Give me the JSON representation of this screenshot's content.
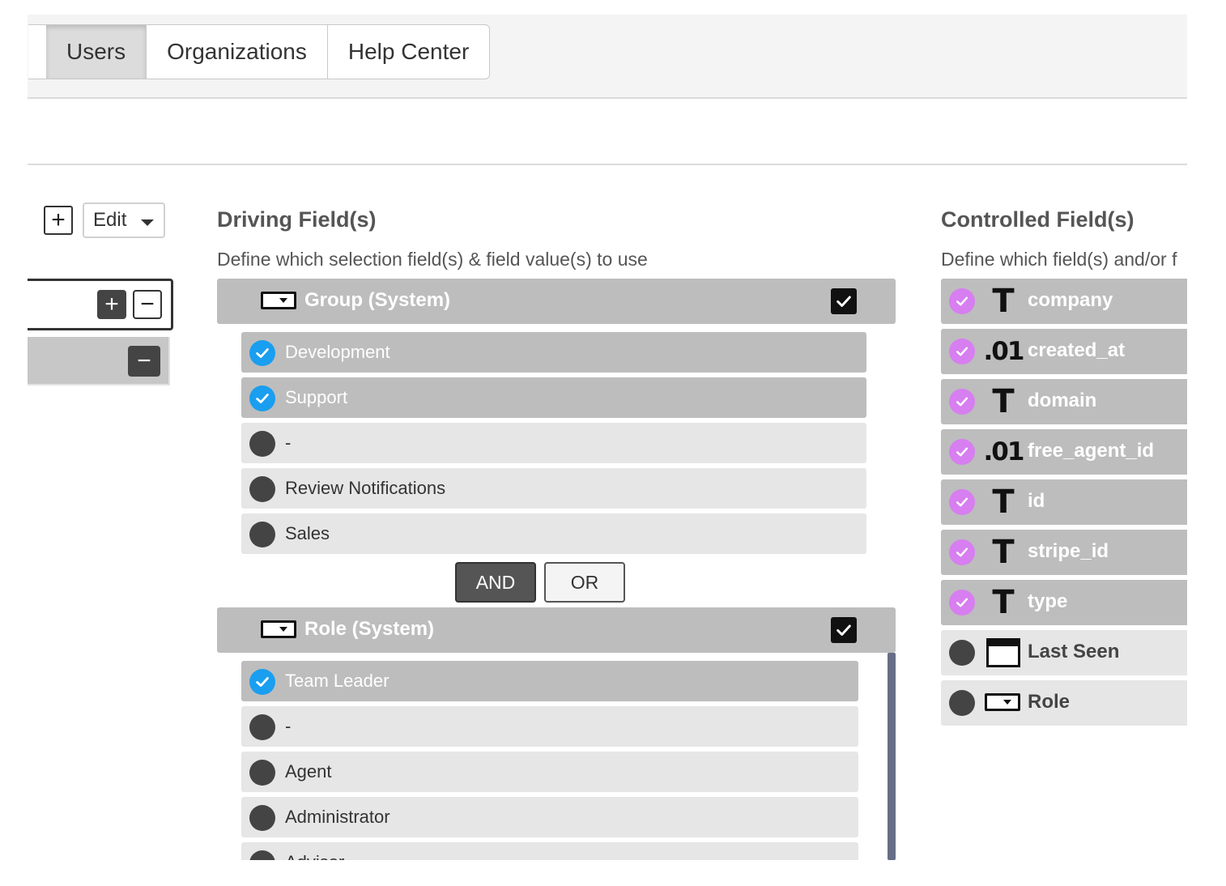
{
  "tabs": [
    {
      "label": "Users",
      "active": true
    },
    {
      "label": "Organizations",
      "active": false
    },
    {
      "label": "Help Center",
      "active": false
    }
  ],
  "left_controls": {
    "add_icon": "plus-icon",
    "edit_label": "Edit"
  },
  "driving": {
    "title": "Driving Field(s)",
    "description": "Define which selection field(s) & field value(s) to use",
    "fields": [
      {
        "label": "Group (System)",
        "checked": true,
        "values": [
          {
            "label": "Development",
            "selected": true
          },
          {
            "label": "Support",
            "selected": true
          },
          {
            "label": "-",
            "selected": false
          },
          {
            "label": "Review Notifications",
            "selected": false
          },
          {
            "label": "Sales",
            "selected": false
          }
        ]
      },
      {
        "label": "Role (System)",
        "checked": true,
        "values": [
          {
            "label": "Team Leader",
            "selected": true
          },
          {
            "label": "-",
            "selected": false
          },
          {
            "label": "Agent",
            "selected": false
          },
          {
            "label": "Administrator",
            "selected": false
          },
          {
            "label": "Advisor",
            "selected": false
          }
        ]
      }
    ],
    "logic": {
      "and_label": "AND",
      "or_label": "OR",
      "selected": "AND"
    }
  },
  "controlled": {
    "title": "Controlled Field(s)",
    "description": "Define which field(s) and/or f",
    "fields": [
      {
        "label": "company",
        "type_icon": "T",
        "selected": true
      },
      {
        "label": "created_at",
        "type_icon": ".01",
        "selected": true
      },
      {
        "label": "domain",
        "type_icon": "T",
        "selected": true
      },
      {
        "label": "free_agent_id",
        "type_icon": ".01",
        "selected": true
      },
      {
        "label": "id",
        "type_icon": "T",
        "selected": true
      },
      {
        "label": "stripe_id",
        "type_icon": "T",
        "selected": true
      },
      {
        "label": "type",
        "type_icon": "T",
        "selected": true
      },
      {
        "label": "Last Seen",
        "type_icon": "calendar-icon",
        "selected": false
      },
      {
        "label": "Role",
        "type_icon": "dropdown-icon",
        "selected": false
      }
    ]
  },
  "colors": {
    "selected_row": "#bdbdbd",
    "unselected_row": "#e6e6e6",
    "blue_check": "#1a9ef0",
    "purple_check": "#d77ef0",
    "scrollbar": "#676f87"
  }
}
